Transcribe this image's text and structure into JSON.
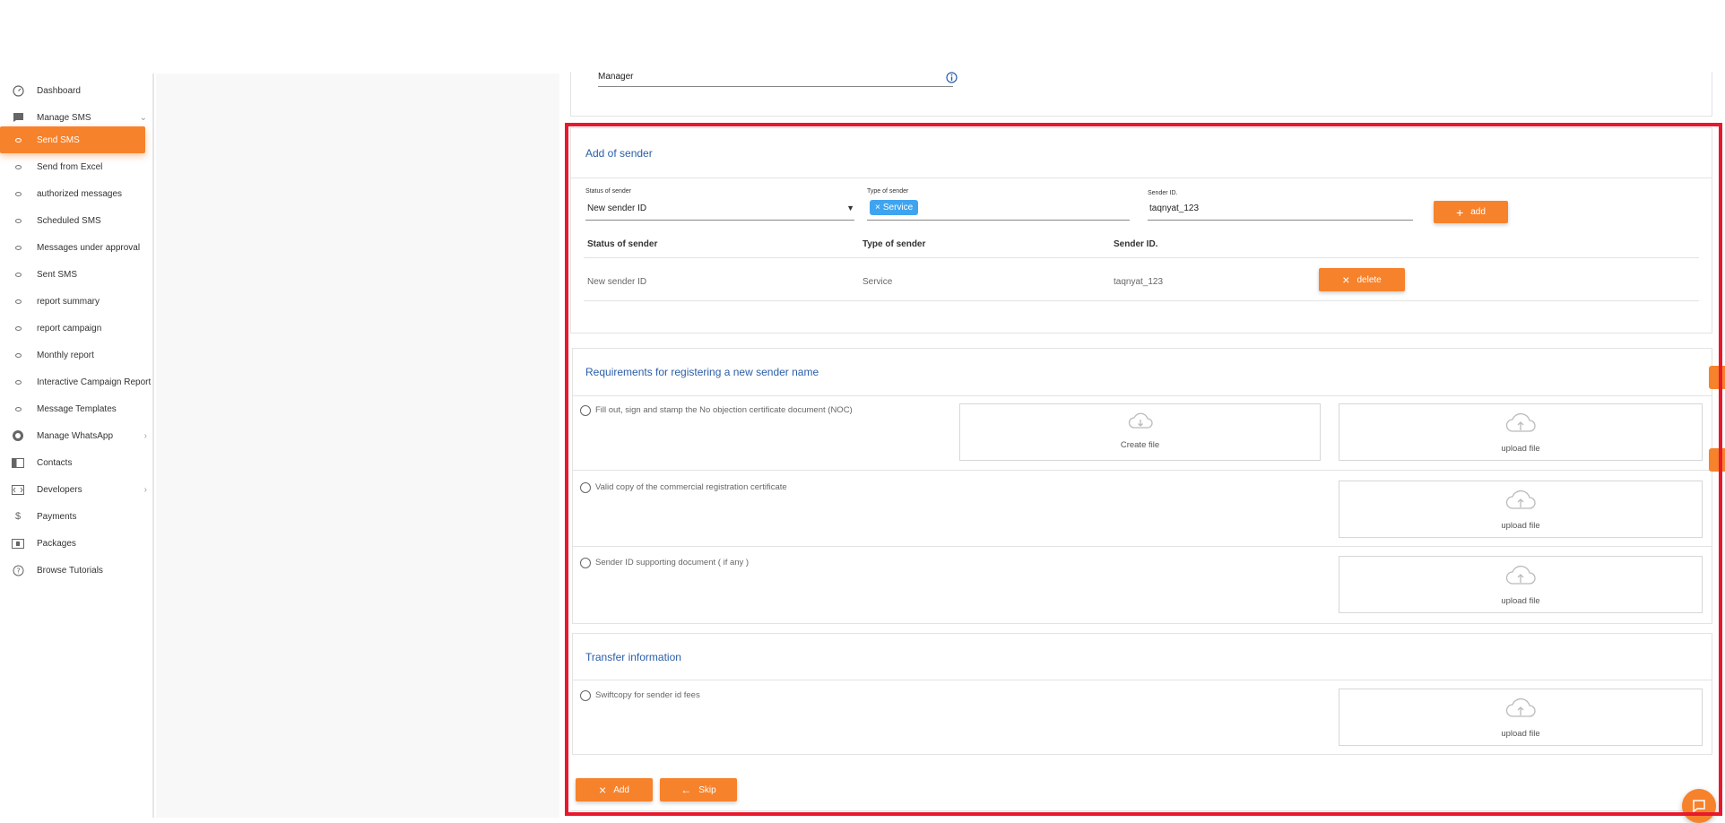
{
  "sidebar": {
    "items": [
      {
        "label": "Dashboard",
        "icon": "dashboard-icon"
      },
      {
        "label": "Manage SMS",
        "icon": "message-icon"
      },
      {
        "label": "Send SMS",
        "icon": "circle-icon"
      },
      {
        "label": "Send from Excel",
        "icon": "circle-icon"
      },
      {
        "label": "authorized messages",
        "icon": "circle-icon"
      },
      {
        "label": "Scheduled SMS",
        "icon": "circle-icon"
      },
      {
        "label": "Messages under approval",
        "icon": "circle-icon"
      },
      {
        "label": "Sent SMS",
        "icon": "circle-icon"
      },
      {
        "label": "report summary",
        "icon": "circle-icon"
      },
      {
        "label": "report campaign",
        "icon": "circle-icon"
      },
      {
        "label": "Monthly report",
        "icon": "circle-icon"
      },
      {
        "label": "Interactive Campaign Report",
        "icon": "circle-icon"
      },
      {
        "label": "Message Templates",
        "icon": "circle-icon"
      },
      {
        "label": "Manage WhatsApp",
        "icon": "whatsapp-icon"
      },
      {
        "label": "Contacts",
        "icon": "contacts-icon"
      },
      {
        "label": "Developers",
        "icon": "developers-icon"
      },
      {
        "label": "Payments",
        "icon": "dollar-icon"
      },
      {
        "label": "Packages",
        "icon": "packages-icon"
      },
      {
        "label": "Browse Tutorials",
        "icon": "help-icon"
      }
    ]
  },
  "top_card": {
    "manager_value": "Manager"
  },
  "sender_card": {
    "title": "Add of sender",
    "status_label": "Status of sender",
    "status_value": "New sender ID",
    "type_label": "Type of sender",
    "type_chip": "Service",
    "sender_id_label": "Sender ID.",
    "sender_id_value": "taqnyat_123",
    "add_label": "add",
    "table": {
      "headers": [
        "Status of sender",
        "Type of sender",
        "Sender ID."
      ],
      "row": [
        "New sender ID",
        "Service",
        "taqnyat_123"
      ],
      "delete_label": "delete"
    }
  },
  "requirements": {
    "title": "Requirements for registering a new sender name",
    "items": [
      "Fill out, sign and stamp the No objection certificate document (NOC)",
      "Valid copy of the commercial registration certificate",
      "Sender ID supporting document ( if any )"
    ],
    "create_file_label": "Create file",
    "upload_label": "upload file"
  },
  "transfer": {
    "title": "Transfer information",
    "item": "Swiftcopy for sender id fees",
    "upload_label": "upload file"
  },
  "footer": {
    "add_label": "Add",
    "skip_label": "Skip"
  },
  "colors": {
    "accent": "#f7822c",
    "title_blue": "#2a5ea8",
    "chip_blue": "#3fa4f0",
    "highlight_red": "#e8182d"
  }
}
